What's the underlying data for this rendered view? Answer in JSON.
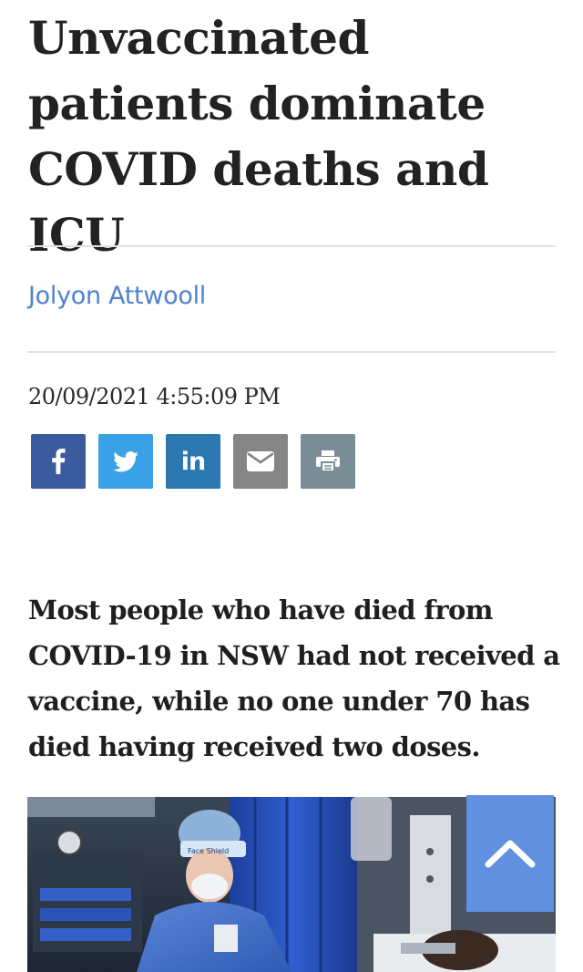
{
  "article": {
    "headline": "Unvaccinated patients dominate COVID deaths and ICU",
    "author": "Jolyon Attwooll",
    "published": "20/09/2021 4:55:09 PM",
    "standfirst": "Most people who have died from COVID-19 in NSW had not received a vaccine, while no one under 70 has died having received two doses."
  },
  "share": {
    "buttons": [
      {
        "name": "facebook",
        "icon": "facebook-icon",
        "color": "#3b5b9f"
      },
      {
        "name": "twitter",
        "icon": "twitter-icon",
        "color": "#3ba1e6"
      },
      {
        "name": "linkedin",
        "icon": "linkedin-icon",
        "label": "in",
        "color": "#2b78b1"
      },
      {
        "name": "email",
        "icon": "envelope-icon",
        "color": "#858585"
      },
      {
        "name": "print",
        "icon": "printer-icon",
        "color": "#7a8c95"
      }
    ]
  },
  "hero_image": {
    "badge_text": "Face Shield"
  },
  "back_to_top": {
    "icon": "chevron-up-icon",
    "color": "#6290e0"
  },
  "colors": {
    "author_link": "#4f82cf",
    "headline": "#222222",
    "rule": "#e2e2e2"
  }
}
